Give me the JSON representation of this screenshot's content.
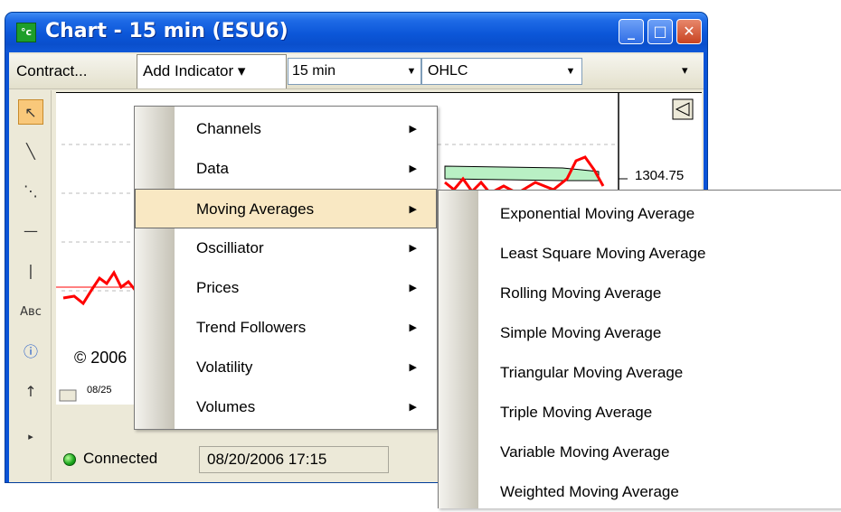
{
  "window": {
    "title": "Chart - 15 min (ESU6)",
    "app_icon_text": "°c",
    "minimize_glyph": "_",
    "maximize_glyph": "□",
    "close_glyph": "✕"
  },
  "toolbar": {
    "contract_label": "Contract...",
    "add_indicator_label": "Add Indicator ▾",
    "interval_value": "15 min",
    "chart_type_value": "OHLC",
    "dropdown_arrow": "▼",
    "grip": "▾"
  },
  "tools": [
    "pointer-icon",
    "line-icon",
    "parallel-lines-icon",
    "horizontal-line-icon",
    "vertical-line-icon",
    "text-icon",
    "info-icon",
    "arrow-up-icon",
    "expand-icon"
  ],
  "tool_glyphs": {
    "pointer": "↖",
    "line": "╲",
    "parallel": "⋱",
    "horizontal": "—",
    "vertical": "|",
    "text": "Aвc",
    "info": "ⓘ",
    "arrow": "↑",
    "expand": "▸"
  },
  "chart": {
    "price_label": "1304.75",
    "copyright_text": "© 2006",
    "date_tick": "08/25"
  },
  "status": {
    "connected_text": "Connected",
    "timestamp": "08/20/2006 17:15"
  },
  "indicator_menu": {
    "items": [
      {
        "label": "Channels"
      },
      {
        "label": "Data"
      },
      {
        "label": "Moving Averages"
      },
      {
        "label": "Oscilliator"
      },
      {
        "label": "Prices"
      },
      {
        "label": "Trend Followers"
      },
      {
        "label": "Volatility"
      },
      {
        "label": "Volumes"
      }
    ],
    "active_index": 2,
    "submenu_arrow": "▶"
  },
  "moving_averages_menu": {
    "items": [
      {
        "label": "Exponential Moving Average"
      },
      {
        "label": "Least Square Moving Average"
      },
      {
        "label": "Rolling Moving Average"
      },
      {
        "label": "Simple Moving Average"
      },
      {
        "label": "Triangular Moving Average"
      },
      {
        "label": "Triple Moving Average"
      },
      {
        "label": "Variable Moving Average"
      },
      {
        "label": "Weighted Moving Average"
      }
    ]
  },
  "colors": {
    "title_bar": "#0b56d8",
    "menu_highlight": "#f9e8c3",
    "price_line": "#ff0000",
    "band_fill": "#b9f0c4",
    "connected_led": "#18a51a"
  }
}
